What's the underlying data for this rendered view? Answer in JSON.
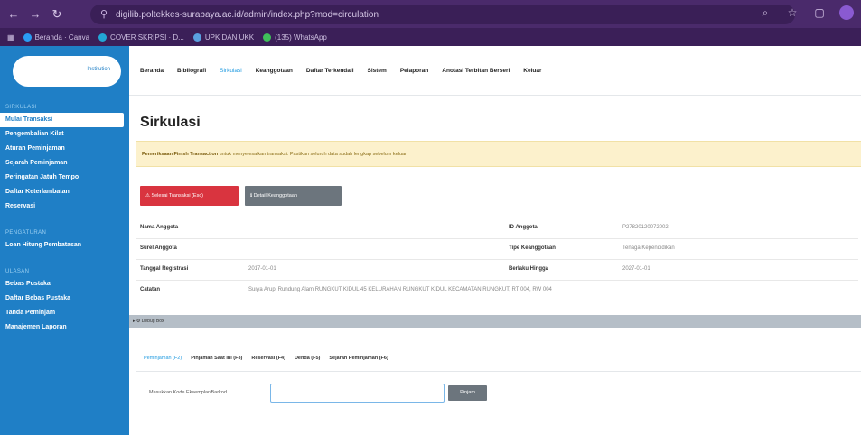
{
  "browser": {
    "url": "digilib.poltekkes-surabaya.ac.id/admin/index.php?mod=circulation",
    "bookmarks": [
      {
        "label": "Beranda · Canva",
        "color": "#2a9df4"
      },
      {
        "label": "COVER SKRIPSI · D...",
        "color": "#22a6d6"
      },
      {
        "label": "UPK DAN UKK",
        "color": "#5aa0e0"
      },
      {
        "label": "(135) WhatsApp",
        "color": "#3fbf5a"
      }
    ]
  },
  "sidebar": {
    "brand_label": "Institution",
    "sections": [
      {
        "title": "SIRKULASI",
        "items": [
          {
            "label": "Mulai Transaksi",
            "active": true
          },
          {
            "label": "Pengembalian Kilat",
            "active": false
          },
          {
            "label": "Aturan Peminjaman",
            "active": false
          },
          {
            "label": "Sejarah Peminjaman",
            "active": false
          },
          {
            "label": "Peringatan Jatuh Tempo",
            "active": false
          },
          {
            "label": "Daftar Keterlambatan",
            "active": false
          },
          {
            "label": "Reservasi",
            "active": false
          }
        ]
      },
      {
        "title": "PENGATURAN",
        "items": [
          {
            "label": "Loan Hitung Pembatasan",
            "active": false
          }
        ]
      },
      {
        "title": "ULASAN",
        "items": [
          {
            "label": "Bebas Pustaka",
            "active": false
          },
          {
            "label": "Daftar Bebas Pustaka",
            "active": false
          },
          {
            "label": "Tanda Peminjam",
            "active": false
          },
          {
            "label": "Manajemen Laporan",
            "active": false
          }
        ]
      }
    ]
  },
  "topnav": {
    "items": [
      {
        "label": "Beranda",
        "current": false
      },
      {
        "label": "Bibliografi",
        "current": false
      },
      {
        "label": "Sirkulasi",
        "current": true
      },
      {
        "label": "Keanggotaan",
        "current": false
      },
      {
        "label": "Daftar Terkendali",
        "current": false
      },
      {
        "label": "Sistem",
        "current": false
      },
      {
        "label": "Pelaporan",
        "current": false
      },
      {
        "label": "Anotasi Terbitan Berseri",
        "current": false
      },
      {
        "label": "Keluar",
        "current": false
      }
    ]
  },
  "page": {
    "title": "Sirkulasi",
    "alert_strong": "Pemeriksaan",
    "alert_mid": "Finish Transaction",
    "alert_text": "untuk menyelesaikan transaksi. Pastikan seluruh data sudah lengkap sebelum keluar."
  },
  "actions": {
    "finish_label": "⚠ Selesai Transaksi (Esc)",
    "member_detail_label": "ℹ Detail Keanggotaan"
  },
  "member": {
    "name_label": "Nama Anggota",
    "name_value": "",
    "id_label": "ID Anggota",
    "id_value": "P27820120072002",
    "email_label": "Surel Anggota",
    "email_value": "",
    "type_label": "Tipe Keanggotaan",
    "type_value": "Tenaga Kependidikan",
    "register_label": "Tanggal Registrasi",
    "register_value": "2017-01-01",
    "expire_label": "Berlaku Hingga",
    "expire_value": "2027-01-01",
    "note_label": "Catatan",
    "note_value": "Surya Arupi Rundung Alam RUNGKUT KIDUL 45 KELURAHAN RUNGKUT KIDUL KECAMATAN RUNGKUT, RT 004, RW 004"
  },
  "debug": {
    "label": "▸ ⚙ Debug Box"
  },
  "tabs": [
    {
      "label": "Peminjaman (F2)",
      "active": true
    },
    {
      "label": "Pinjaman Saat ini (F3)",
      "active": false
    },
    {
      "label": "Reservasi (F4)",
      "active": false
    },
    {
      "label": "Denda (F5)",
      "active": false
    },
    {
      "label": "Sejarah Peminjaman (F6)",
      "active": false
    }
  ],
  "loan_form": {
    "label": "Masukkan Kode Eksemplar/Barkod",
    "input_value": "",
    "input_placeholder": "",
    "submit_label": "Pinjam"
  }
}
